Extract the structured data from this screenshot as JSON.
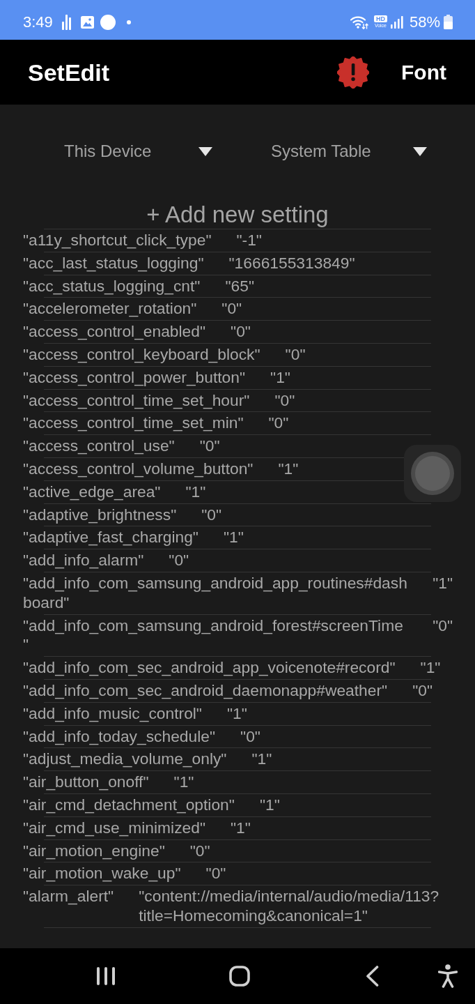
{
  "status_bar": {
    "time": "3:49",
    "hd_voice": {
      "badge": "HD",
      "label": "Voice"
    },
    "battery": "58%"
  },
  "app_bar": {
    "title": "SetEdit",
    "action": "Font"
  },
  "dropdowns": [
    {
      "value": "This Device"
    },
    {
      "value": "System Table"
    }
  ],
  "add_button": "+ Add new setting",
  "settings": [
    {
      "key": "\"a11y_shortcut_click_type\"",
      "value": "\"-1\""
    },
    {
      "key": "\"acc_last_status_logging\"",
      "value": "\"1666155313849\""
    },
    {
      "key": "\"acc_status_logging_cnt\"",
      "value": "\"65\""
    },
    {
      "key": "\"accelerometer_rotation\"",
      "value": "\"0\""
    },
    {
      "key": "\"access_control_enabled\"",
      "value": "\"0\""
    },
    {
      "key": "\"access_control_keyboard_block\"",
      "value": "\"0\""
    },
    {
      "key": "\"access_control_power_button\"",
      "value": "\"1\""
    },
    {
      "key": "\"access_control_time_set_hour\"",
      "value": "\"0\""
    },
    {
      "key": "\"access_control_time_set_min\"",
      "value": "\"0\""
    },
    {
      "key": "\"access_control_use\"",
      "value": "\"0\""
    },
    {
      "key": "\"access_control_volume_button\"",
      "value": "\"1\""
    },
    {
      "key": "\"active_edge_area\"",
      "value": "\"1\""
    },
    {
      "key": "\"adaptive_brightness\"",
      "value": "\"0\""
    },
    {
      "key": "\"adaptive_fast_charging\"",
      "value": "\"1\""
    },
    {
      "key": "\"add_info_alarm\"",
      "value": "\"0\""
    },
    {
      "key": "\"add_info_com_samsung_android_app_routines#dashboard\"",
      "value": "\"1\""
    },
    {
      "key": "\"add_info_com_samsung_android_forest#screenTime\"",
      "value": "\"0\""
    },
    {
      "key": "\"add_info_com_sec_android_app_voicenote#record\"",
      "value": "\"1\""
    },
    {
      "key": "\"add_info_com_sec_android_daemonapp#weather\"",
      "value": "\"0\""
    },
    {
      "key": "\"add_info_music_control\"",
      "value": "\"1\""
    },
    {
      "key": "\"add_info_today_schedule\"",
      "value": "\"0\""
    },
    {
      "key": "\"adjust_media_volume_only\"",
      "value": "\"1\""
    },
    {
      "key": "\"air_button_onoff\"",
      "value": "\"1\""
    },
    {
      "key": "\"air_cmd_detachment_option\"",
      "value": "\"1\""
    },
    {
      "key": "\"air_cmd_use_minimized\"",
      "value": "\"1\""
    },
    {
      "key": "\"air_motion_engine\"",
      "value": "\"0\""
    },
    {
      "key": "\"air_motion_wake_up\"",
      "value": "\"0\""
    },
    {
      "key": "\"alarm_alert\"",
      "value": "\"content://media/internal/audio/media/113?title=Homecoming&canonical=1\""
    }
  ]
}
